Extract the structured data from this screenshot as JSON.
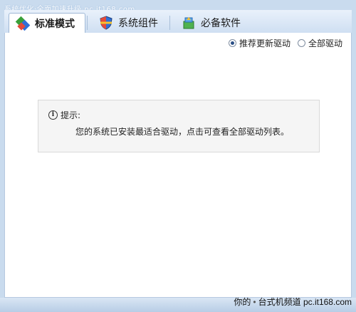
{
  "watermark_top": "系统优化·全面加速升级 pc.it168.com",
  "tabs": [
    {
      "label": "标准模式",
      "icon": "standard-mode-icon",
      "active": true
    },
    {
      "label": "系统组件",
      "icon": "shield-icon",
      "active": false
    },
    {
      "label": "必备软件",
      "icon": "software-package-icon",
      "active": false
    }
  ],
  "options": {
    "recommended_label": "推荐更新驱动",
    "recommended_selected": true,
    "all_label": "全部驱动",
    "all_selected": false
  },
  "notice": {
    "title": "提示:",
    "message": "您的系统已安装最适合驱动，点击可查看全部驱动列表。"
  },
  "watermark_bottom": {
    "part1": "你的",
    "dot": "•",
    "part2": "台式机频道",
    "site": "pc.it168.com"
  },
  "colors": {
    "accent": "#2a4f86",
    "tab_bar": "#cfdff2",
    "panel_border": "#9fb8d6"
  }
}
